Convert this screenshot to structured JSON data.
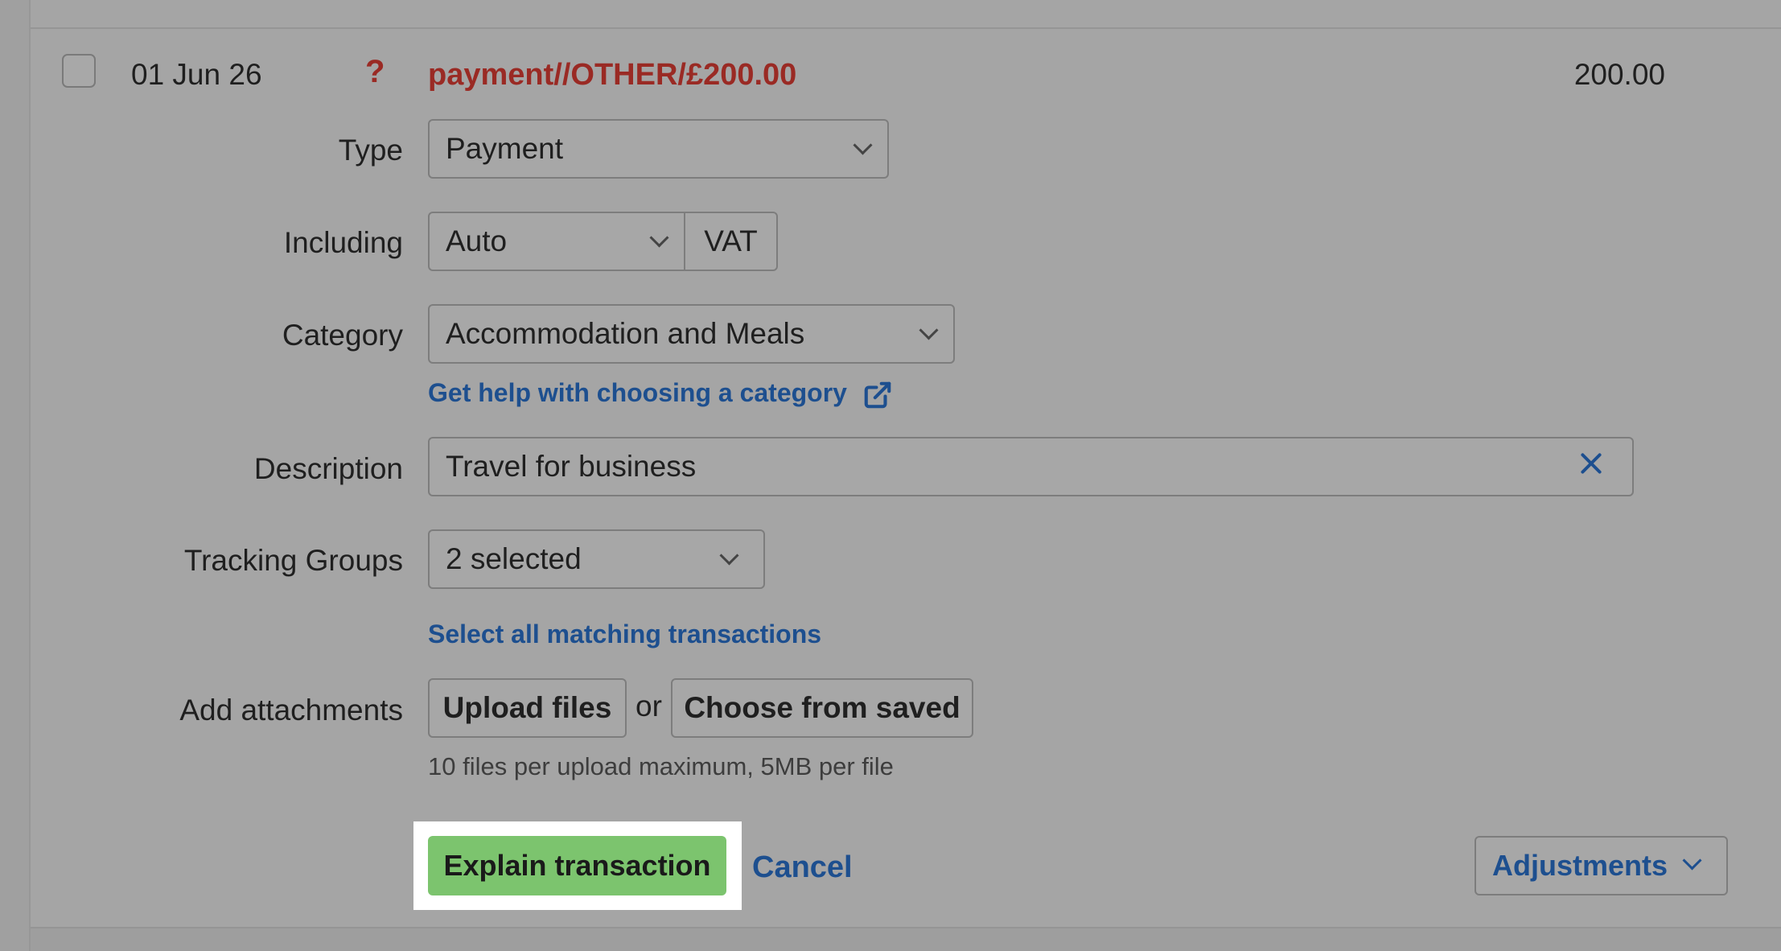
{
  "transaction": {
    "date": "01 Jun 26",
    "status_glyph": "?",
    "title": "payment//OTHER/£200.00",
    "amount": "200.00"
  },
  "form": {
    "type": {
      "label": "Type",
      "value": "Payment"
    },
    "including": {
      "label": "Including",
      "value": "Auto",
      "addon": "VAT"
    },
    "category": {
      "label": "Category",
      "value": "Accommodation and Meals",
      "help_link": "Get help with choosing a category"
    },
    "description": {
      "label": "Description",
      "value": "Travel for business"
    },
    "tracking": {
      "label": "Tracking Groups",
      "value": "2 selected"
    },
    "select_all_link": "Select all matching transactions",
    "attachments": {
      "label": "Add attachments",
      "upload_button": "Upload files",
      "or": "or",
      "saved_button": "Choose from saved",
      "hint": "10 files per upload maximum, 5MB per file"
    }
  },
  "actions": {
    "primary": "Explain transaction",
    "cancel": "Cancel",
    "adjustments": "Adjustments"
  },
  "colors": {
    "primary_button": "#7cc46e",
    "link": "#1d4f8f",
    "negative": "#9a2a24"
  }
}
